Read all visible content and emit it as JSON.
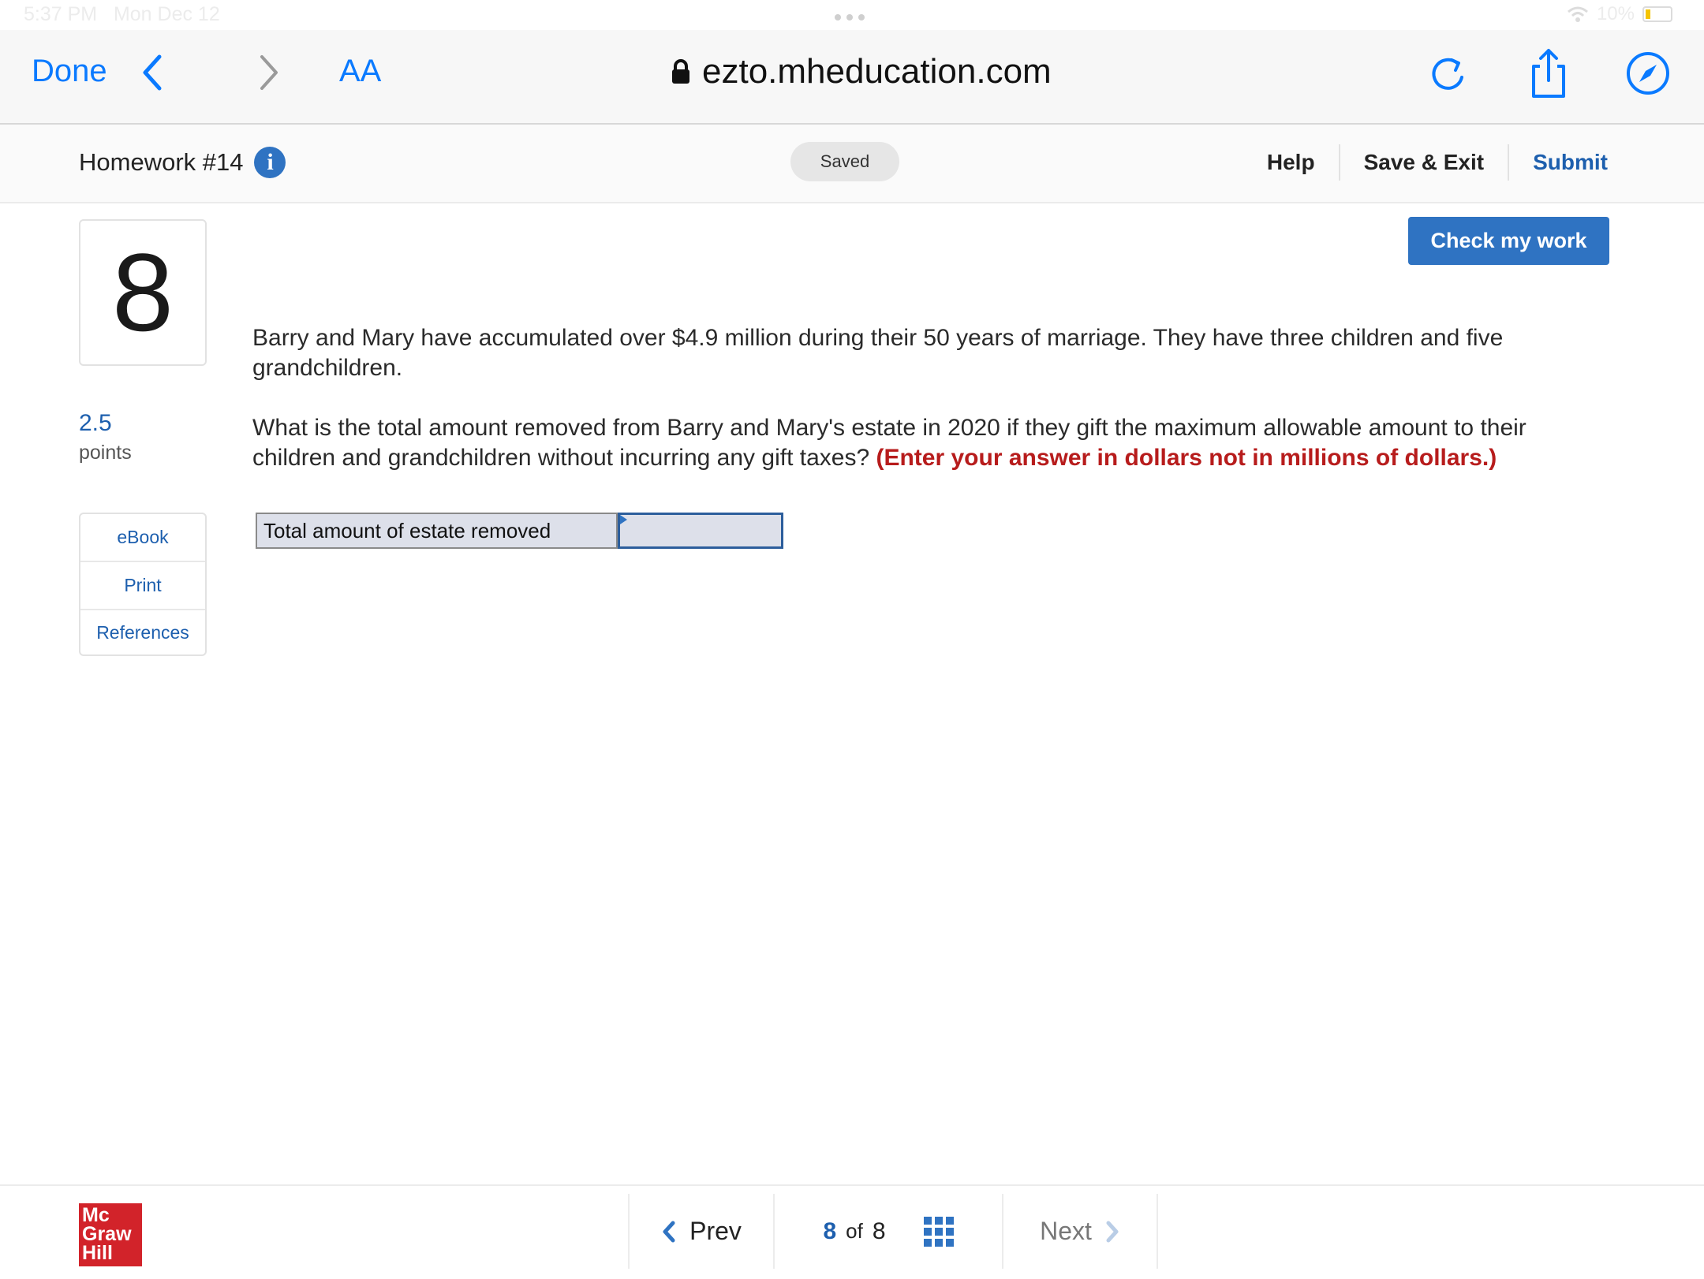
{
  "status_bar": {
    "time": "5:37 PM",
    "date": "Mon Dec 12",
    "battery": "10%"
  },
  "browser": {
    "done_label": "Done",
    "text_size_label": "AA",
    "url": "ezto.mheducation.com"
  },
  "header": {
    "title": "Homework #14",
    "info_glyph": "i",
    "saved_label": "Saved",
    "help_label": "Help",
    "save_exit_label": "Save & Exit",
    "submit_label": "Submit"
  },
  "check_button_label": "Check my work",
  "question": {
    "number": "8",
    "points_value": "2.5",
    "points_label": "points",
    "paragraph1": "Barry and Mary have accumulated over $4.9 million during their 50 years of marriage. They have three children and five grandchildren.",
    "paragraph2": "What is the total amount removed from Barry and Mary's estate in 2020 if they gift the maximum allowable amount to their children and grandchildren without incurring any gift taxes?",
    "instruction": "(Enter your answer in dollars not in millions of dollars.)"
  },
  "side_links": {
    "ebook": "eBook",
    "print": "Print",
    "references": "References"
  },
  "answer": {
    "label": "Total amount of estate removed",
    "value": ""
  },
  "footer": {
    "logo_line1": "Mc",
    "logo_line2": "Graw",
    "logo_line3": "Hill",
    "prev_label": "Prev",
    "current": "8",
    "of_label": "of",
    "total": "8",
    "next_label": "Next"
  },
  "colors": {
    "accent": "#2f73c2",
    "ios_blue": "#0a7aff",
    "instruction_red": "#b71c1c",
    "brand_red": "#d2232a"
  }
}
